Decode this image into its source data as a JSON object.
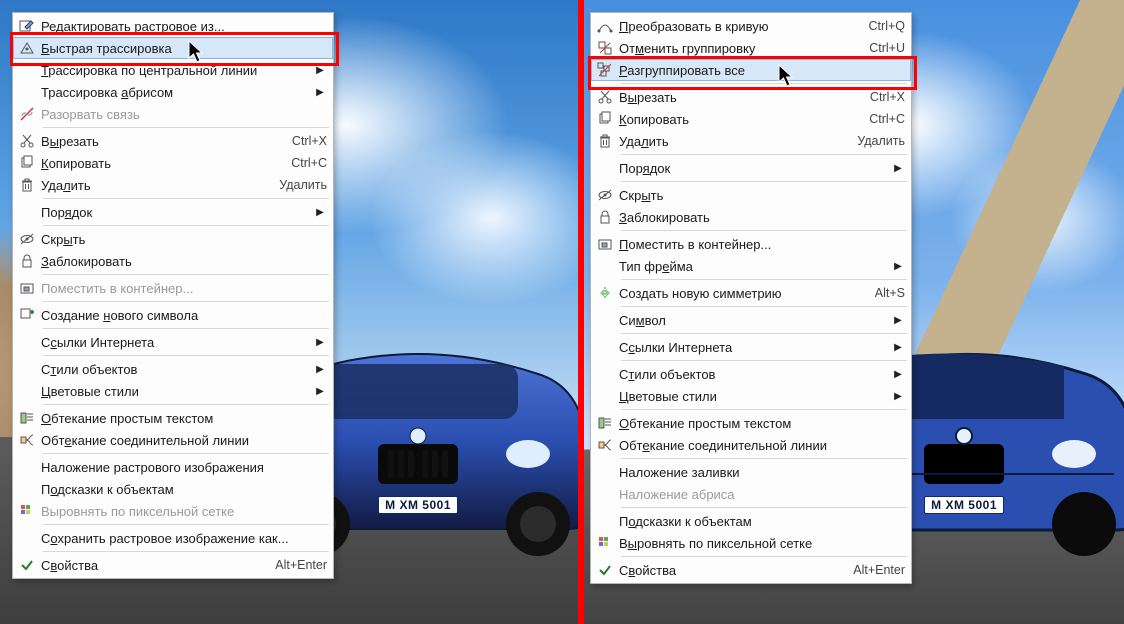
{
  "license_plate": "M  XM 5001",
  "car_color": "#2a4fb0",
  "left_menu": {
    "highlight_index": 1,
    "items": [
      {
        "icon": "edit-bitmap-icon",
        "label_html": "<span class='mn'>Р</span>едактировать растровое из...",
        "interact": true
      },
      {
        "icon": "quick-trace-icon",
        "label_html": "<span class='mn'>Б</span>ыстрая трассировка",
        "interact": true
      },
      {
        "icon": "",
        "label_html": "<span class='mn'>Т</span>рассировка по центральной линии",
        "submenu": true,
        "interact": true
      },
      {
        "icon": "",
        "label_html": "Трассировка <span class='mn'>а</span>брисом",
        "submenu": true,
        "interact": true
      },
      {
        "icon": "break-link-icon",
        "label_html": "Разорвать связь",
        "disabled": true,
        "interact": false
      },
      {
        "sep": true
      },
      {
        "icon": "cut-icon",
        "label_html": "В<span class='mn'>ы</span>резать",
        "shortcut": "Ctrl+X",
        "interact": true
      },
      {
        "icon": "copy-icon",
        "label_html": "<span class='mn'>К</span>опировать",
        "shortcut": "Ctrl+C",
        "interact": true
      },
      {
        "icon": "delete-icon",
        "label_html": "Уда<span class='mn'>л</span>ить",
        "shortcut": "Удалить",
        "interact": true
      },
      {
        "sep": true
      },
      {
        "icon": "",
        "label_html": "Пор<span class='mn'>я</span>док",
        "submenu": true,
        "interact": true
      },
      {
        "sep": true
      },
      {
        "icon": "hide-icon",
        "label_html": "Скр<span class='mn'>ы</span>ть",
        "interact": true
      },
      {
        "icon": "lock-icon",
        "label_html": "<span class='mn'>З</span>аблокировать",
        "interact": true
      },
      {
        "sep": true
      },
      {
        "icon": "container-icon",
        "label_html": "Поместить в контейнер...",
        "disabled": true,
        "interact": false
      },
      {
        "sep": true
      },
      {
        "icon": "new-symbol-icon",
        "label_html": "Создание <span class='mn'>н</span>ового символа",
        "interact": true
      },
      {
        "sep": true
      },
      {
        "icon": "",
        "label_html": "С<span class='mn'>с</span>ылки Интернета",
        "submenu": true,
        "interact": true
      },
      {
        "sep": true
      },
      {
        "icon": "",
        "label_html": "С<span class='mn'>т</span>или объектов",
        "submenu": true,
        "interact": true
      },
      {
        "icon": "",
        "label_html": "<span class='mn'>Ц</span>ветовые стили",
        "submenu": true,
        "interact": true
      },
      {
        "sep": true
      },
      {
        "icon": "wrap-text-icon",
        "label_html": "<span class='mn'>О</span>бтекание простым текстом",
        "interact": true
      },
      {
        "icon": "connector-wrap-icon",
        "label_html": "Обт<span class='mn'>е</span>кание соединительной линии",
        "interact": true
      },
      {
        "sep": true
      },
      {
        "icon": "",
        "label_html": "Наложение растрового изображения",
        "interact": true
      },
      {
        "icon": "",
        "label_html": "П<span class='mn'>о</span>дсказки к объектам",
        "interact": true
      },
      {
        "icon": "pixel-align-icon",
        "label_html": "Выровнять по пиксельной сетке",
        "disabled": true,
        "interact": false
      },
      {
        "sep": true
      },
      {
        "icon": "",
        "label_html": "С<span class='mn'>о</span>хранить растровое изображение как...",
        "interact": true
      },
      {
        "sep": true
      },
      {
        "icon": "check-icon",
        "label_html": "С<span class='mn'>в</span>ойства",
        "shortcut": "Alt+Enter",
        "interact": true
      }
    ]
  },
  "right_menu": {
    "highlight_index": 2,
    "items": [
      {
        "icon": "to-curve-icon",
        "label_html": "<span class='mn'>П</span>реобразовать в кривую",
        "shortcut": "Ctrl+Q",
        "interact": true
      },
      {
        "icon": "ungroup-icon",
        "label_html": "От<span class='mn'>м</span>енить группировку",
        "shortcut": "Ctrl+U",
        "interact": true
      },
      {
        "icon": "ungroup-all-icon",
        "label_html": "<span class='mn'>Р</span>азгруппировать все",
        "interact": true
      },
      {
        "sep": true
      },
      {
        "icon": "cut-icon",
        "label_html": "В<span class='mn'>ы</span>резать",
        "shortcut": "Ctrl+X",
        "interact": true
      },
      {
        "icon": "copy-icon",
        "label_html": "<span class='mn'>К</span>опировать",
        "shortcut": "Ctrl+C",
        "interact": true
      },
      {
        "icon": "delete-icon",
        "label_html": "Уда<span class='mn'>л</span>ить",
        "shortcut": "Удалить",
        "interact": true
      },
      {
        "sep": true
      },
      {
        "icon": "",
        "label_html": "Пор<span class='mn'>я</span>док",
        "submenu": true,
        "interact": true
      },
      {
        "sep": true
      },
      {
        "icon": "hide-icon",
        "label_html": "Скр<span class='mn'>ы</span>ть",
        "interact": true
      },
      {
        "icon": "lock-icon",
        "label_html": "<span class='mn'>З</span>аблокировать",
        "interact": true
      },
      {
        "sep": true
      },
      {
        "icon": "container-icon",
        "label_html": "<span class='mn'>П</span>оместить в контейнер...",
        "interact": true
      },
      {
        "icon": "",
        "label_html": "Тип фр<span class='mn'>е</span>йма",
        "submenu": true,
        "interact": true
      },
      {
        "sep": true
      },
      {
        "icon": "symmetry-icon",
        "label_html": "Соз<span class='mn'>д</span>ать новую симметрию",
        "shortcut": "Alt+S",
        "interact": true
      },
      {
        "sep": true
      },
      {
        "icon": "",
        "label_html": "Си<span class='mn'>м</span>вол",
        "submenu": true,
        "interact": true
      },
      {
        "sep": true
      },
      {
        "icon": "",
        "label_html": "С<span class='mn'>с</span>ылки Интернета",
        "submenu": true,
        "interact": true
      },
      {
        "sep": true
      },
      {
        "icon": "",
        "label_html": "С<span class='mn'>т</span>или объектов",
        "submenu": true,
        "interact": true
      },
      {
        "icon": "",
        "label_html": "<span class='mn'>Ц</span>ветовые стили",
        "submenu": true,
        "interact": true
      },
      {
        "sep": true
      },
      {
        "icon": "wrap-text-icon",
        "label_html": "<span class='mn'>О</span>бтекание простым текстом",
        "interact": true
      },
      {
        "icon": "connector-wrap-icon",
        "label_html": "Обт<span class='mn'>е</span>кание соединительной линии",
        "interact": true
      },
      {
        "sep": true
      },
      {
        "icon": "",
        "label_html": "Наложение заливки",
        "interact": true
      },
      {
        "icon": "",
        "label_html": "Наложение абриса",
        "disabled": true,
        "interact": false
      },
      {
        "sep": true
      },
      {
        "icon": "",
        "label_html": "П<span class='mn'>о</span>дсказки к объектам",
        "interact": true
      },
      {
        "icon": "pixel-align-icon",
        "label_html": "В<span class='mn'>ы</span>ровнять по пиксельной сетке",
        "interact": true
      },
      {
        "sep": true
      },
      {
        "icon": "check-icon",
        "label_html": "С<span class='mn'>в</span>ойства",
        "shortcut": "Alt+Enter",
        "interact": true
      }
    ]
  }
}
